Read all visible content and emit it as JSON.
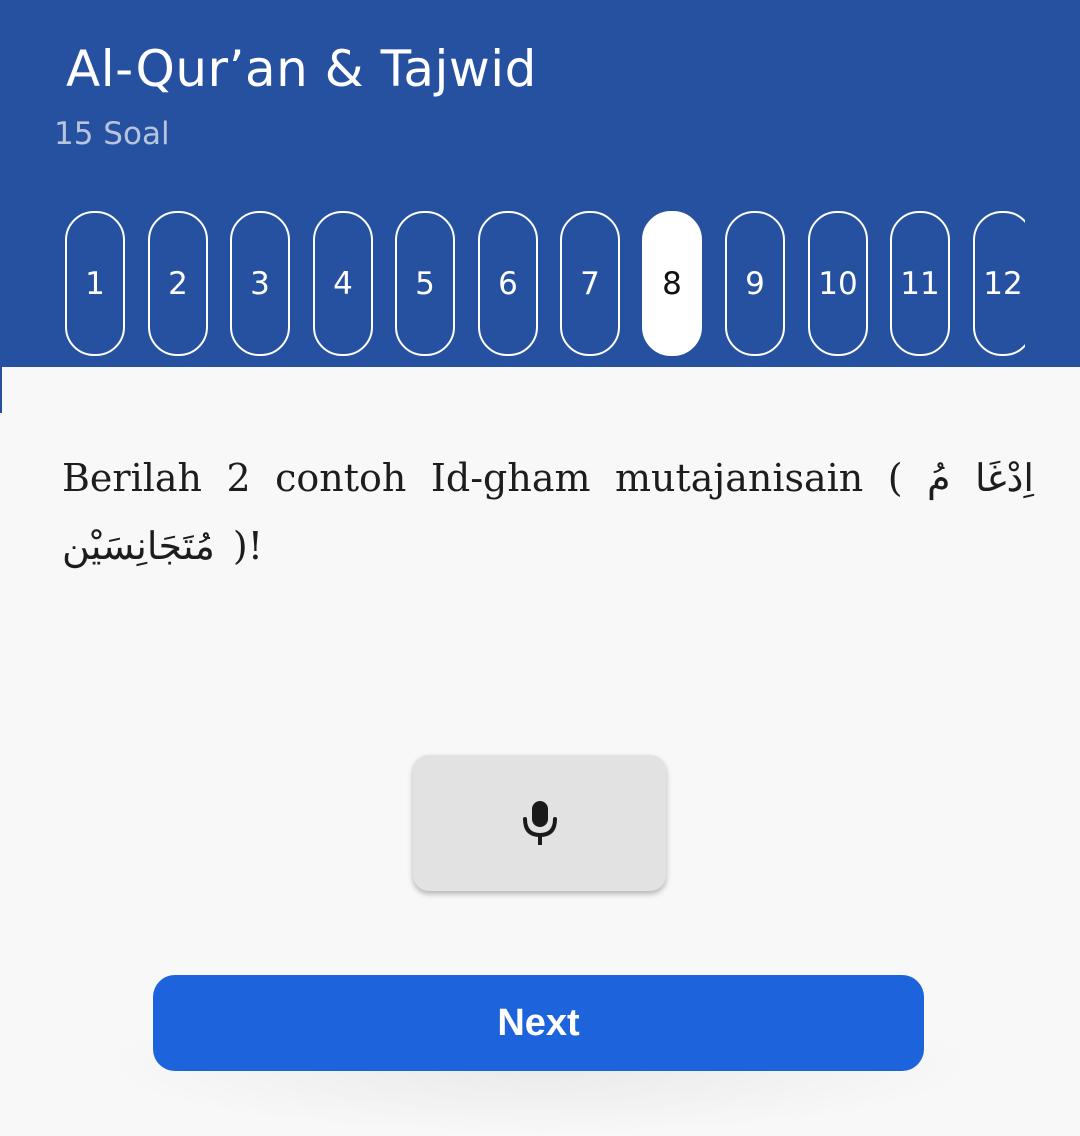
{
  "header": {
    "title": "Al-Qur’an & Tajwid",
    "subtitle": "15 Soal",
    "background_color": "#2651a0"
  },
  "question_nav": {
    "items": [
      "1",
      "2",
      "3",
      "4",
      "5",
      "6",
      "7",
      "8",
      "9",
      "10",
      "11",
      "12"
    ],
    "active_item": "8"
  },
  "question": {
    "text": "Berilah 2 contoh Id-gham mutajanisain ( اِدْغَا مُ مُتَجَانِسَيْن )!"
  },
  "mic_button": {
    "icon": "microphone-icon"
  },
  "next_button": {
    "label": "Next",
    "color": "#1d63dc"
  }
}
